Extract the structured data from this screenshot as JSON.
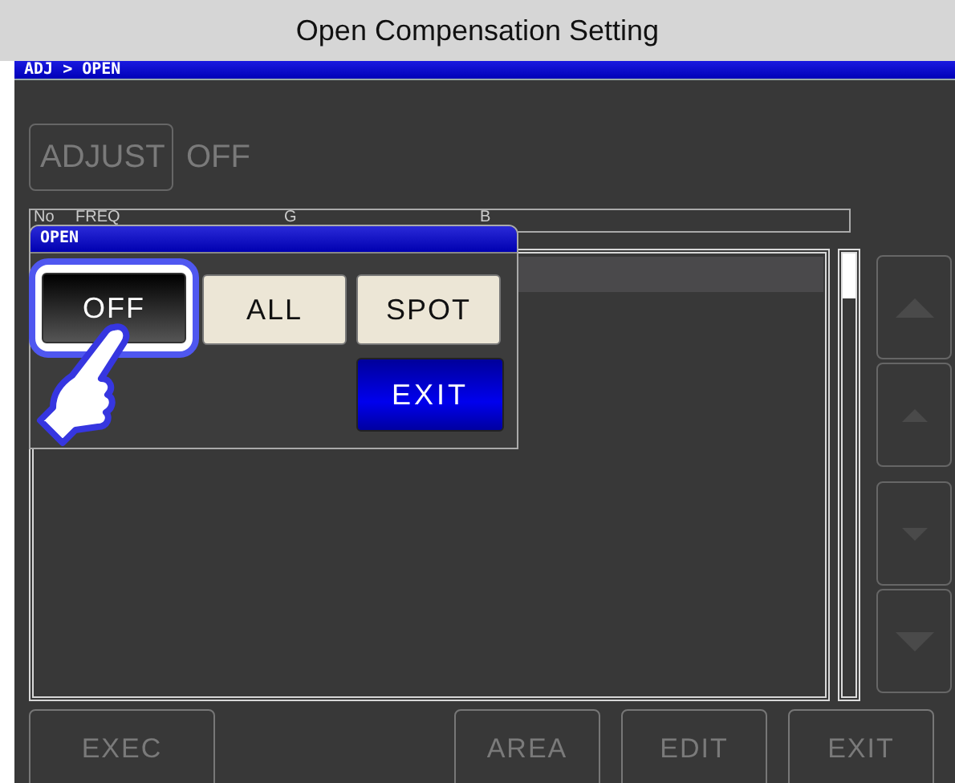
{
  "page_title": "Open Compensation Setting",
  "breadcrumb": "ADJ > OPEN",
  "adjust": {
    "button": "ADJUST",
    "value": "OFF",
    "disabled": true
  },
  "table": {
    "columns": [
      "No",
      "FREQ",
      "G",
      "B"
    ]
  },
  "bottom_buttons": [
    {
      "label": "EXEC",
      "disabled": true
    },
    {
      "label": "AREA",
      "disabled": true
    },
    {
      "label": "EDIT",
      "disabled": true
    },
    {
      "label": "EXIT",
      "disabled": true
    }
  ],
  "dialog": {
    "title": "OPEN",
    "options": [
      {
        "label": "OFF",
        "selected": true
      },
      {
        "label": "ALL",
        "selected": false
      },
      {
        "label": "SPOT",
        "selected": false
      }
    ],
    "exit": "EXIT"
  }
}
